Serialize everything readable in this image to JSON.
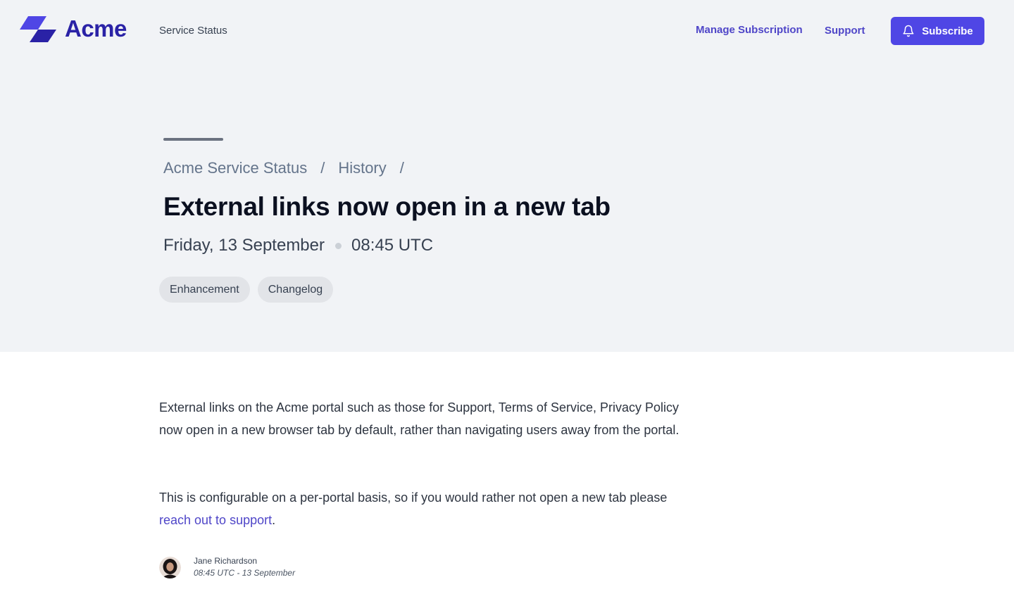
{
  "header": {
    "brand": "Acme",
    "service_status": "Service Status",
    "manage_subscription": "Manage Subscription",
    "support": "Support",
    "subscribe": "Subscribe"
  },
  "breadcrumb": {
    "root": "Acme Service Status",
    "history": "History",
    "separator": "/"
  },
  "post": {
    "title": "External links now open in a new tab",
    "date": "Friday, 13 September",
    "time": "08:45 UTC",
    "tags": [
      "Enhancement",
      "Changelog"
    ],
    "paragraph1": "External links on the Acme portal such as those for Support, Terms of Service, Privacy Policy now open in a new browser tab by default, rather than navigating users away from the portal.",
    "paragraph2_prefix": "This is configurable on a per-portal basis, so if you would rather not open a new tab please ",
    "paragraph2_link": "reach out to support",
    "paragraph2_suffix": "."
  },
  "author": {
    "name": "Jane Richardson",
    "timestamp": "08:45 UTC - 13 September"
  },
  "colors": {
    "brand": "#2a22a6",
    "accent": "#4f46e5",
    "link": "#4f46c8",
    "hero_bg": "#f1f3f6"
  },
  "icons": {
    "logo": "acme-logo-icon",
    "bell": "bell-icon",
    "avatar": "user-avatar"
  }
}
